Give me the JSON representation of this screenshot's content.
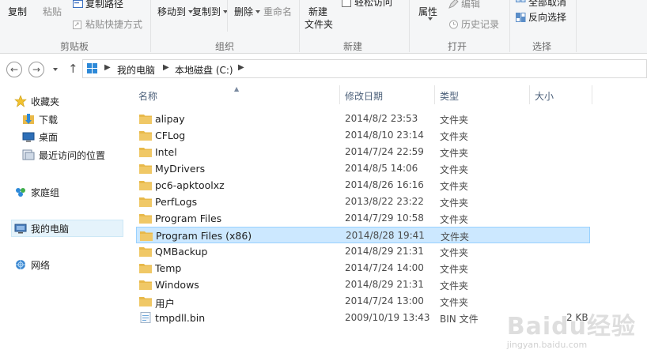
{
  "ribbon": {
    "clipboard": {
      "copy": "复制",
      "paste": "粘贴",
      "copy_path": "复制路径",
      "paste_shortcut": "粘贴快捷方式",
      "group": "剪贴板"
    },
    "organize": {
      "move_to": "移动到",
      "copy_to": "复制到",
      "delete": "删除",
      "rename": "重命名",
      "group": "组织"
    },
    "new": {
      "new_folder_line1": "新建",
      "new_folder_line2": "文件夹",
      "easy_access": "轻松访问",
      "group": "新建"
    },
    "open": {
      "properties": "属性",
      "edit": "编辑",
      "history": "历史记录",
      "group": "打开"
    },
    "select": {
      "select_none": "全部取消",
      "invert": "反向选择",
      "group": "选择"
    }
  },
  "address": {
    "crumbs": [
      "我的电脑",
      "本地磁盘 (C:)"
    ]
  },
  "navpane": {
    "favorites": "收藏夹",
    "downloads": "下载",
    "desktop": "桌面",
    "recent": "最近访问的位置",
    "homegroup": "家庭组",
    "computer": "我的电脑",
    "network": "网络"
  },
  "columns": {
    "name": "名称",
    "date": "修改日期",
    "type": "类型",
    "size": "大小"
  },
  "files": [
    {
      "name": "alipay",
      "date": "2014/8/2 23:53",
      "type": "文件夹",
      "size": ""
    },
    {
      "name": "CFLog",
      "date": "2014/8/10 23:14",
      "type": "文件夹",
      "size": ""
    },
    {
      "name": "Intel",
      "date": "2014/7/24 22:59",
      "type": "文件夹",
      "size": ""
    },
    {
      "name": "MyDrivers",
      "date": "2014/8/5 14:06",
      "type": "文件夹",
      "size": ""
    },
    {
      "name": "pc6-apktoolxz",
      "date": "2014/8/26 16:16",
      "type": "文件夹",
      "size": ""
    },
    {
      "name": "PerfLogs",
      "date": "2013/8/22 23:22",
      "type": "文件夹",
      "size": ""
    },
    {
      "name": "Program Files",
      "date": "2014/7/29 10:58",
      "type": "文件夹",
      "size": ""
    },
    {
      "name": "Program Files (x86)",
      "date": "2014/8/28 19:41",
      "type": "文件夹",
      "size": ""
    },
    {
      "name": "QMBackup",
      "date": "2014/8/29 21:31",
      "type": "文件夹",
      "size": ""
    },
    {
      "name": "Temp",
      "date": "2014/7/24 14:00",
      "type": "文件夹",
      "size": ""
    },
    {
      "name": "Windows",
      "date": "2014/8/29 21:31",
      "type": "文件夹",
      "size": ""
    },
    {
      "name": "用户",
      "date": "2014/7/24 13:00",
      "type": "文件夹",
      "size": ""
    },
    {
      "name": "tmpdll.bin",
      "date": "2009/10/19 13:43",
      "type": "BIN 文件",
      "size": "2 KB"
    }
  ],
  "watermark": {
    "main": "Baidu经验",
    "sub": "jingyan.baidu.com"
  },
  "colors": {
    "folder": "#e8b94a",
    "selection": "#cce8ff",
    "selection_border": "#99d1ff"
  }
}
